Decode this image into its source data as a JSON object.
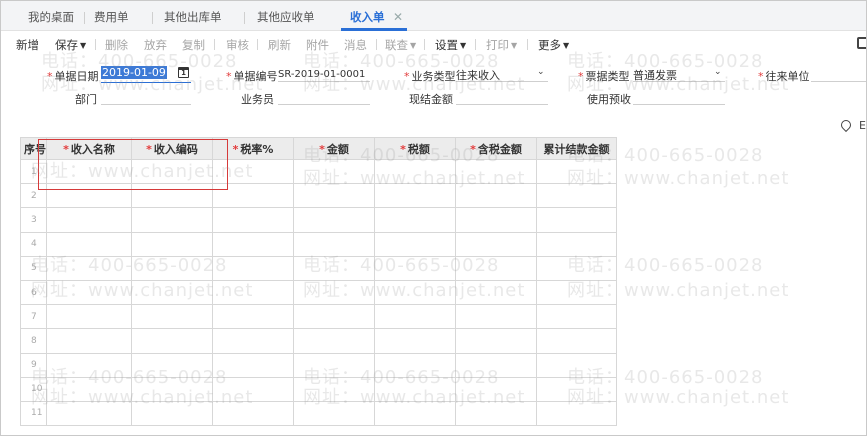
{
  "tabs": [
    {
      "label": "我的桌面"
    },
    {
      "label": "费用单"
    },
    {
      "label": "其他出库单"
    },
    {
      "label": "其他应收单"
    },
    {
      "label": "收入单"
    }
  ],
  "toolbar": {
    "add": "新增",
    "save": "保存",
    "delete": "删除",
    "discard": "放弃",
    "copy": "复制",
    "audit": "审核",
    "refresh": "刷新",
    "attachment": "附件",
    "message": "消息",
    "link_query": "联查",
    "settings": "设置",
    "print": "打印",
    "more": "更多"
  },
  "form": {
    "doc_date_label": "单据日期",
    "doc_date_value": "2019-01-09",
    "doc_no_label": "单据编号",
    "doc_no_value": "SR-2019-01-0001",
    "biz_type_label": "业务类型",
    "biz_type_value": "往来收入",
    "invoice_type_label": "票据类型",
    "invoice_type_value": "普通发票",
    "counterparty_label": "往来单位",
    "department_label": "部门",
    "salesperson_label": "业务员",
    "cash_settlement_label": "现结金额",
    "use_prepay_label": "使用预收"
  },
  "grid": {
    "columns": [
      "序号",
      "收入名称",
      "收入编码",
      "税率%",
      "金额",
      "税额",
      "含税金额",
      "累计结款金额"
    ],
    "required": [
      false,
      true,
      true,
      true,
      true,
      true,
      true,
      false
    ],
    "rows": [
      "1",
      "2",
      "3",
      "4",
      "5",
      "6",
      "7",
      "8",
      "9",
      "10",
      "11"
    ]
  },
  "watermark": {
    "phone": "电话：400-665-0028",
    "site": "网址：www.chanjet.net"
  }
}
